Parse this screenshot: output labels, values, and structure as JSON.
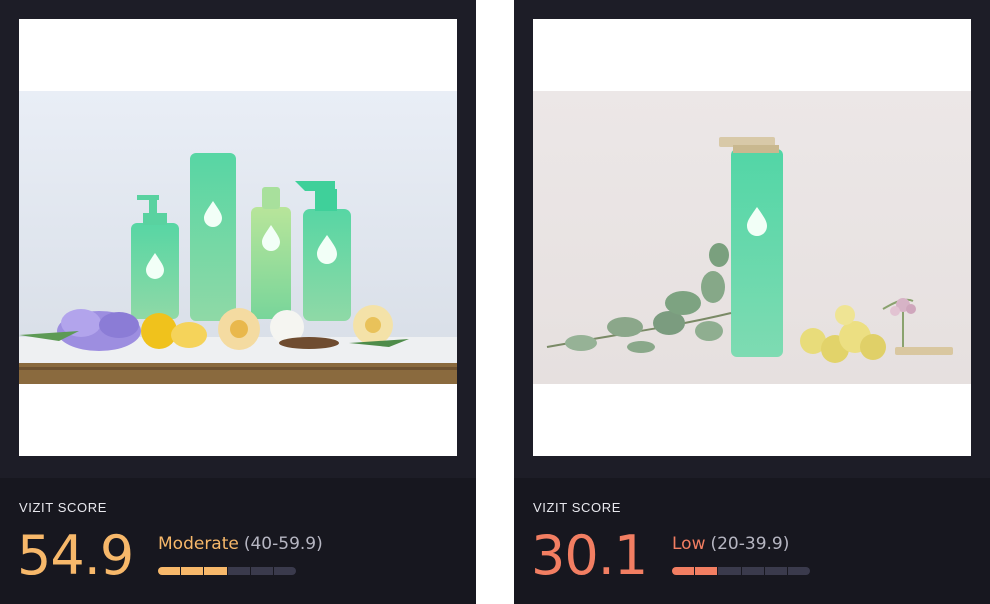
{
  "cards": [
    {
      "image_alt": "Safely cleaning products with flowers and lemons",
      "score_label": "VIZIT SCORE",
      "score": "54.9",
      "rating": "Moderate",
      "range": "(40-59.9)",
      "meter_filled_segments": 3,
      "meter_total_segments": 6,
      "accent_color": "#f7b86a"
    },
    {
      "image_alt": "Safely bottle with eucalyptus and yellow flowers",
      "score_label": "VIZIT SCORE",
      "score": "30.1",
      "rating": "Low",
      "range": "(20-39.9)",
      "meter_filled_segments": 2,
      "meter_total_segments": 6,
      "accent_color": "#f27e62"
    }
  ],
  "colors": {
    "card_background": "#1d1d27",
    "panel_background": "#17171f",
    "meter_empty": "#3a3a4c"
  },
  "icons": [
    "drop-logo-icon"
  ]
}
